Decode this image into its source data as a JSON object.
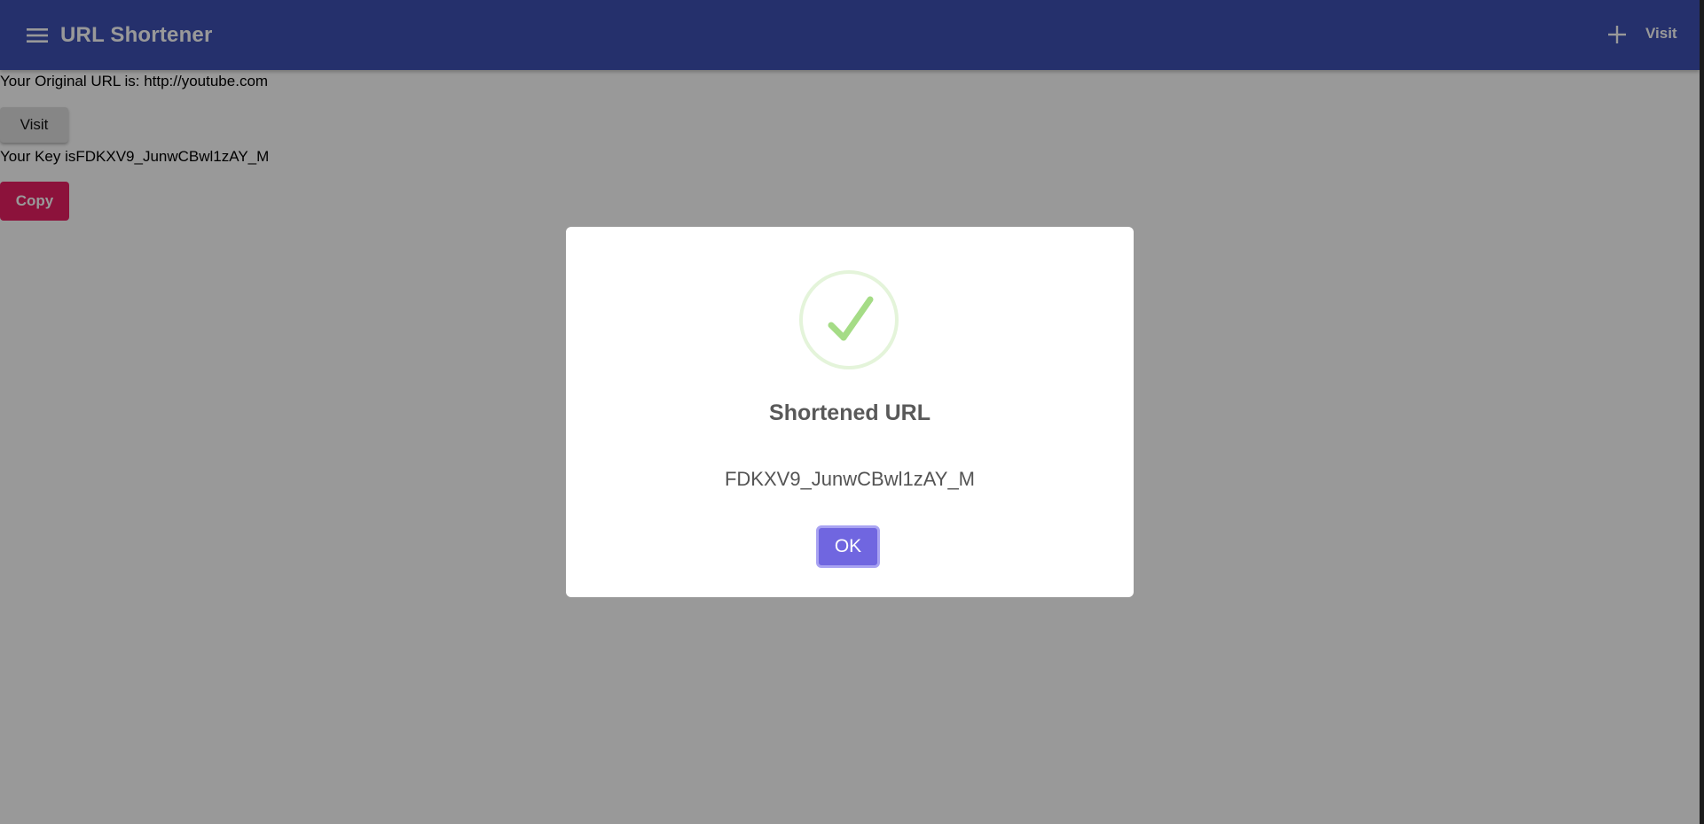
{
  "appbar": {
    "title": "URL Shortener",
    "visit_label": "Visit",
    "menu_icon": "menu-icon",
    "add_icon": "plus-icon",
    "color": "#3f51b5"
  },
  "content": {
    "original_url_text": "Your Original URL is: http://youtube.com",
    "visit_button_label": "Visit",
    "key_text": "Your Key isFDKXV9_JunwCBwl1zAY_M",
    "copy_button_label": "Copy",
    "copy_button_color": "#e91e63"
  },
  "modal": {
    "icon": "success-check-icon",
    "title": "Shortened URL",
    "text": "FDKXV9_JunwCBwl1zAY_M",
    "ok_label": "OK",
    "ok_color": "#7066e0",
    "success_color": "#a5dc86"
  }
}
